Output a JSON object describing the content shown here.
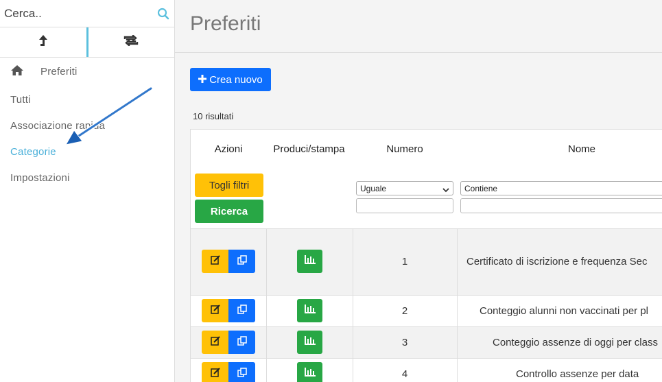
{
  "sidebar": {
    "search_placeholder": "Cerca..",
    "nav": [
      {
        "label": "Preferiti"
      },
      {
        "label": "Tutti"
      },
      {
        "label": "Associazione rapida"
      },
      {
        "label": "Categorie"
      },
      {
        "label": "Impostazioni"
      }
    ]
  },
  "main": {
    "title": "Preferiti",
    "create_label": "Crea nuovo",
    "results_label": "10 risultati",
    "columns": {
      "actions": "Azioni",
      "produce": "Produci/stampa",
      "number": "Numero",
      "name": "Nome"
    },
    "filters": {
      "clear_label": "Togli filtri",
      "search_label": "Ricerca",
      "number_op": "Uguale",
      "name_op": "Contiene"
    },
    "rows": [
      {
        "number": "1",
        "name": "Certificato di iscrizione e frequenza Sec"
      },
      {
        "number": "2",
        "name": "Conteggio alunni non vaccinati per pl"
      },
      {
        "number": "3",
        "name": "Conteggio assenze di oggi per class"
      },
      {
        "number": "4",
        "name": "Controllo assenze per data"
      }
    ]
  },
  "colors": {
    "accent": "#4ab0d9",
    "primary": "#0d6efd",
    "warning": "#ffc107",
    "success": "#28a745"
  }
}
